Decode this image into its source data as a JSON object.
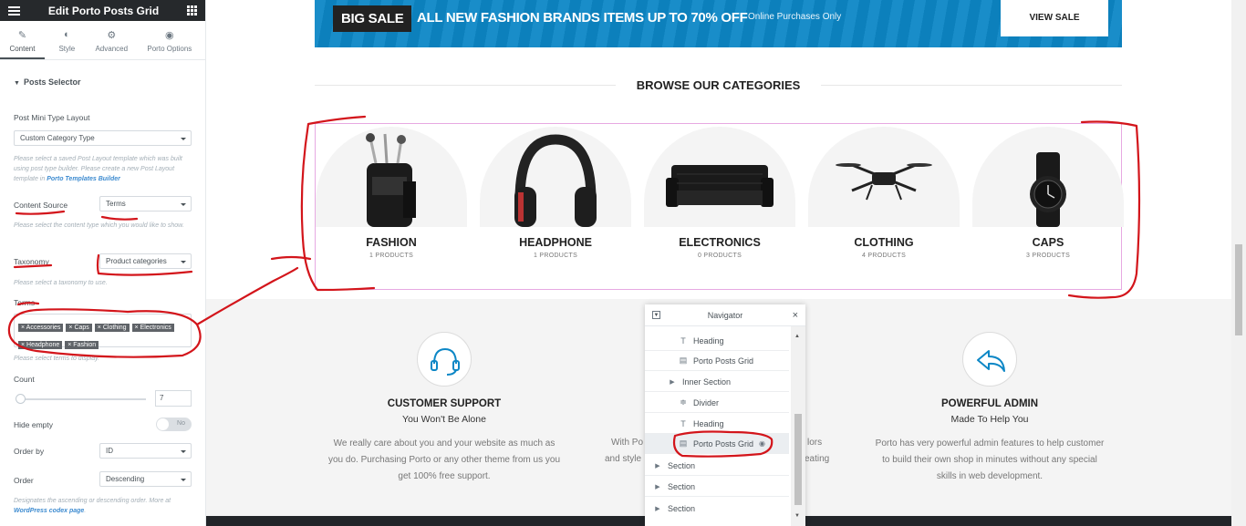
{
  "panel": {
    "title": "Edit Porto Posts Grid",
    "tabs": [
      "Content",
      "Style",
      "Advanced",
      "Porto Options"
    ],
    "section_title": "Posts Selector",
    "post_mini_type_label": "Post Mini Type Layout",
    "post_mini_type_value": "Custom Category Type",
    "post_mini_hint": "Please select a saved Post Layout template which was built using post type builder. Please create a new Post Layout template in ",
    "post_mini_hint_link": "Porto Templates Builder",
    "content_source_label": "Content Source",
    "content_source_value": "Terms",
    "content_source_hint": "Please select the content type which you would like to show.",
    "taxonomy_label": "Taxonomy",
    "taxonomy_value": "Product categories",
    "taxonomy_hint": "Please select a taxonomy to use.",
    "terms_label": "Terms",
    "terms": [
      "Accessories",
      "Caps",
      "Clothing",
      "Electronics",
      "Headphone",
      "Fashion"
    ],
    "terms_hint": "Please select terms to display.",
    "count_label": "Count",
    "count_value": "7",
    "hide_empty_label": "Hide empty",
    "hide_empty_value": "No",
    "order_by_label": "Order by",
    "order_by_value": "ID",
    "order_label": "Order",
    "order_value": "Descending",
    "order_hint": "Designates the ascending or descending order. More at ",
    "order_hint_link": "WordPress codex page",
    "order_hint_end": "."
  },
  "banner": {
    "badge": "BIG SALE",
    "headline": "ALL NEW FASHION BRANDS ITEMS UP TO 70% OFF",
    "sub": "Online Purchases Only",
    "button": "VIEW SALE"
  },
  "categories_title": "BROWSE OUR CATEGORIES",
  "categories": [
    {
      "name": "FASHION",
      "count": "1 PRODUCTS"
    },
    {
      "name": "HEADPHONE",
      "count": "1 PRODUCTS"
    },
    {
      "name": "ELECTRONICS",
      "count": "0 PRODUCTS"
    },
    {
      "name": "CLOTHING",
      "count": "4 PRODUCTS"
    },
    {
      "name": "CAPS",
      "count": "3 PRODUCTS"
    }
  ],
  "features": [
    {
      "title": "CUSTOMER SUPPORT",
      "sub": "You Won't Be Alone",
      "text": "We really care about you and your website as much as you do. Purchasing Porto or any other theme from us you get 100% free support."
    },
    {
      "title": "POWERFUL ADMIN",
      "sub": "Made To Help You",
      "text": "Porto has very powerful admin features to help customer to build their own shop in minutes without any special skills in web development."
    }
  ],
  "partial_feature_text_1": "With Po",
  "partial_feature_text_2": "and style",
  "partial_feature_text_3": "lors",
  "partial_feature_text_4": "eating",
  "navigator": {
    "title": "Navigator",
    "items": [
      "Heading",
      "Porto Posts Grid",
      "Inner Section",
      "Divider",
      "Heading",
      "Porto Posts Grid",
      "Section",
      "Section",
      "Section"
    ]
  },
  "colors": {
    "accent": "#0d87c6",
    "annotation": "#d3151b",
    "panel_dark": "#26292c"
  }
}
